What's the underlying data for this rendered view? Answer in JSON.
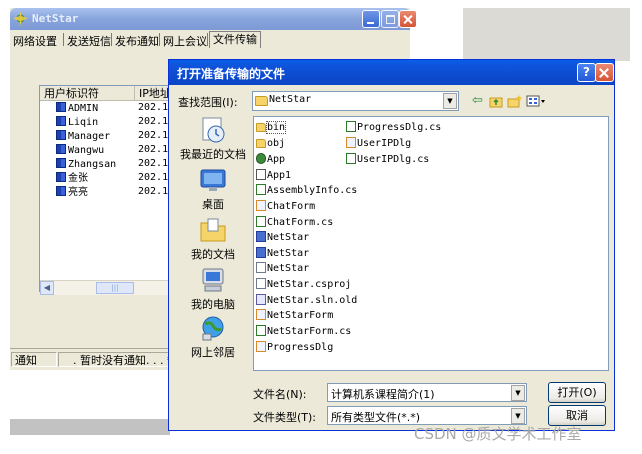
{
  "main_window": {
    "title": "NetStar",
    "menu": [
      "网络设置",
      "发送短信",
      "发布通知",
      "网上会议",
      "文件传输"
    ],
    "columns": [
      "用户标识符",
      "IP地址"
    ],
    "users": [
      {
        "name": "ADMIN",
        "ip": "202.1"
      },
      {
        "name": "Liqin",
        "ip": "202.1"
      },
      {
        "name": "Manager",
        "ip": "202.1"
      },
      {
        "name": "Wangwu",
        "ip": "202.1"
      },
      {
        "name": "Zhangsan",
        "ip": "202.1"
      },
      {
        "name": "金张",
        "ip": "202.1"
      },
      {
        "name": "亮亮",
        "ip": "202.1"
      }
    ],
    "scroll_thumb_glyph": "|||",
    "status_label": "通知",
    "status_text": ". 暂时没有通知. . . **"
  },
  "dialog": {
    "title": "打开准备传输的文件",
    "help_glyph": "?",
    "look_in_label": "查找范围(I):",
    "look_in_value": "NetStar",
    "places": [
      "我最近的文档",
      "桌面",
      "我的文档",
      "我的电脑",
      "网上邻居"
    ],
    "files_col1": [
      {
        "name": "bin",
        "icon": "folder"
      },
      {
        "name": "obj",
        "icon": "folder"
      },
      {
        "name": "App",
        "icon": "app"
      },
      {
        "name": "App1",
        "icon": "blank"
      },
      {
        "name": "AssemblyInfo.cs",
        "icon": "cs"
      },
      {
        "name": "ChatForm",
        "icon": "form"
      },
      {
        "name": "ChatForm.cs",
        "icon": "cs"
      },
      {
        "name": "NetStar",
        "icon": "exe"
      },
      {
        "name": "NetStar",
        "icon": "exe"
      },
      {
        "name": "NetStar",
        "icon": "doc"
      },
      {
        "name": "NetStar.csproj",
        "icon": "doc"
      },
      {
        "name": "NetStar.sln.old",
        "icon": "sln"
      },
      {
        "name": "NetStarForm",
        "icon": "form"
      },
      {
        "name": "NetStarForm.cs",
        "icon": "cs"
      },
      {
        "name": "ProgressDlg",
        "icon": "form"
      }
    ],
    "files_col2": [
      {
        "name": "ProgressDlg.cs",
        "icon": "cs"
      },
      {
        "name": "UserIPDlg",
        "icon": "form"
      },
      {
        "name": "UserIPDlg.cs",
        "icon": "cs"
      }
    ],
    "filename_label": "文件名(N):",
    "filename_value": "计算机系课程简介(1)",
    "filetype_label": "文件类型(T):",
    "filetype_value": "所有类型文件(*.*)",
    "open_button": "打开(O)",
    "cancel_button": "取消"
  },
  "watermark": "CSDN @质文学术工作室",
  "colors": {
    "xp_blue_title": "#0b4fd6",
    "inactive_title": "#8aa6dd",
    "window_bg": "#ece9d8",
    "close_red": "#d65434"
  },
  "icons": {
    "look_in_toolbar": [
      "back-arrow-icon",
      "up-folder-icon",
      "new-folder-icon",
      "view-menu-icon"
    ]
  }
}
